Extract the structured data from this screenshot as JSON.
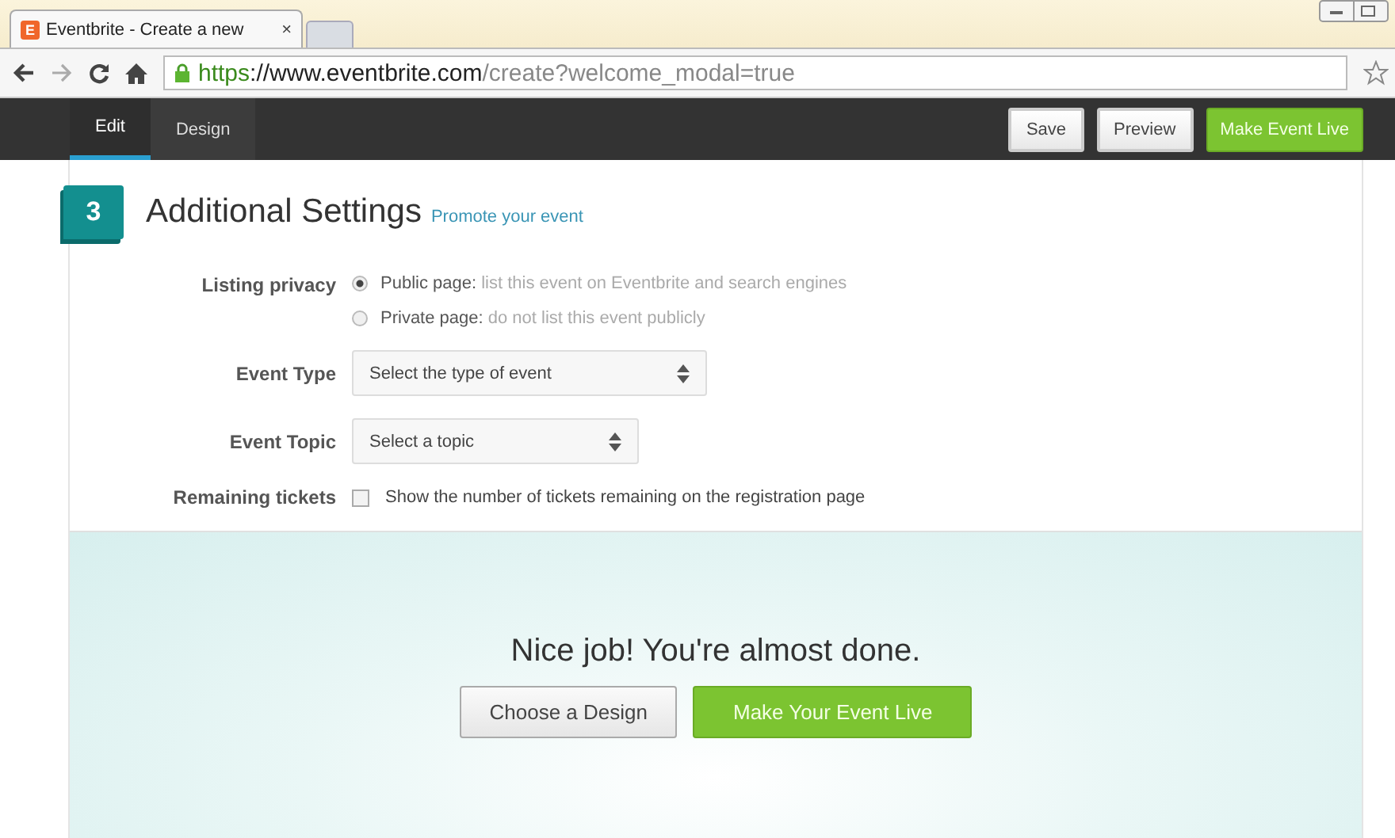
{
  "browser": {
    "tab": {
      "favicon": "E",
      "title": "Eventbrite - Create a new",
      "close": "×"
    },
    "url": {
      "scheme": "https",
      "host": "://www.eventbrite.com",
      "path": "/create?welcome_modal=true"
    }
  },
  "toolbar": {
    "tabs": [
      {
        "label": "Edit",
        "selected": true
      },
      {
        "label": "Design",
        "selected": false
      }
    ],
    "buttons": [
      {
        "label": "Save",
        "kind": "plain"
      },
      {
        "label": "Preview",
        "kind": "plain"
      },
      {
        "label": "Make Event Live",
        "kind": "primary"
      }
    ]
  },
  "section": {
    "number": "3",
    "title": "Additional Settings",
    "link": "Promote your event",
    "listing_privacy": {
      "label": "Listing privacy",
      "options": [
        {
          "name": "Public page:",
          "description": "list this event on Eventbrite and search engines",
          "selected": true
        },
        {
          "name": "Private page:",
          "description": "do not list this event publicly",
          "selected": false
        }
      ]
    },
    "event_type": {
      "label": "Event Type",
      "value": "Select the type of event"
    },
    "event_topic": {
      "label": "Event Topic",
      "value": "Select a topic"
    },
    "remaining_tickets": {
      "label": "Remaining tickets",
      "text": "Show the number of tickets remaining on the registration page",
      "checked": false
    }
  },
  "footer": {
    "message": "Nice job! You're almost done.",
    "buttons": [
      {
        "label": "Choose a Design",
        "kind": "plain"
      },
      {
        "label": "Make Your Event Live",
        "kind": "primary"
      }
    ]
  }
}
